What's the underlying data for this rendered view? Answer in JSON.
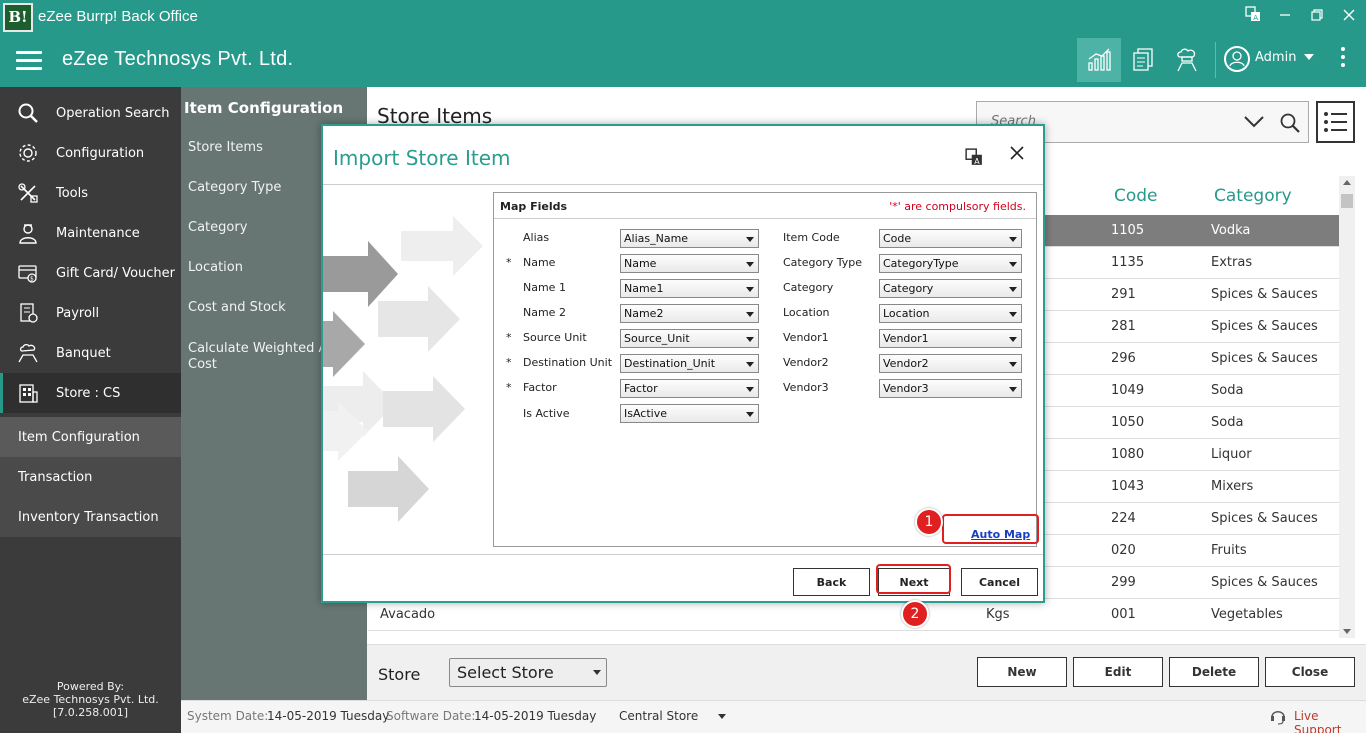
{
  "window": {
    "logo_text": "B!",
    "title": "eZee Burrp! Back Office"
  },
  "header": {
    "company": "eZee Technosys Pvt. Ltd.",
    "user": "Admin",
    "icons": [
      "chart-icon",
      "documents-icon",
      "chef-icon"
    ]
  },
  "sidebar": {
    "items": [
      {
        "label": "Operation Search",
        "icon": "search-icon"
      },
      {
        "label": "Configuration",
        "icon": "gear-icon"
      },
      {
        "label": "Tools",
        "icon": "tools-icon"
      },
      {
        "label": "Maintenance",
        "icon": "maintenance-icon"
      },
      {
        "label": "Gift Card/ Voucher",
        "icon": "gift-card-icon"
      },
      {
        "label": "Payroll",
        "icon": "payroll-icon"
      },
      {
        "label": "Banquet",
        "icon": "banquet-icon"
      },
      {
        "label": "Store : CS",
        "icon": "store-icon"
      }
    ],
    "sub_items": [
      {
        "label": "Item Configuration"
      },
      {
        "label": "Transaction"
      },
      {
        "label": "Inventory Transaction"
      }
    ],
    "powered_by": "Powered By:",
    "powered_company": "eZee Technosys Pvt. Ltd.",
    "version": "[7.0.258.001]"
  },
  "panel2": {
    "title": "Item Configuration",
    "items": [
      {
        "label": "Store Items"
      },
      {
        "label": "Category Type"
      },
      {
        "label": "Category"
      },
      {
        "label": "Location"
      },
      {
        "label": "Cost and Stock"
      },
      {
        "label": "Calculate Weighted Ave Cost"
      }
    ]
  },
  "main": {
    "title": "Store Items",
    "search_placeholder": "Search",
    "columns": {
      "code": "Code",
      "category": "Category"
    },
    "rows": [
      {
        "name": "",
        "unit": "",
        "code": "1105",
        "category": "Vodka"
      },
      {
        "name": "",
        "unit": "",
        "code": "1135",
        "category": "Extras"
      },
      {
        "name": "",
        "unit": "",
        "code": "291",
        "category": "Spices & Sauces"
      },
      {
        "name": "",
        "unit": "",
        "code": "281",
        "category": "Spices & Sauces"
      },
      {
        "name": "",
        "unit": "",
        "code": "296",
        "category": "Spices & Sauces"
      },
      {
        "name": "",
        "unit": "",
        "code": "1049",
        "category": "Soda"
      },
      {
        "name": "",
        "unit": "",
        "code": "1050",
        "category": "Soda"
      },
      {
        "name": "",
        "unit": "",
        "code": "1080",
        "category": "Liquor"
      },
      {
        "name": "",
        "unit": "",
        "code": "1043",
        "category": "Mixers"
      },
      {
        "name": "",
        "unit": "",
        "code": "224",
        "category": "Spices & Sauces"
      },
      {
        "name": "",
        "unit": "",
        "code": "020",
        "category": "Fruits"
      },
      {
        "name": "",
        "unit": "",
        "code": "299",
        "category": "Spices & Sauces"
      },
      {
        "name": "Avacado",
        "unit": "Kgs",
        "code": "001",
        "category": "Vegetables"
      }
    ],
    "store_label": "Store",
    "store_select": "Select Store",
    "buttons": {
      "new": "New",
      "edit": "Edit",
      "delete": "Delete",
      "close": "Close"
    }
  },
  "statusbar": {
    "system_date_label": "System Date:",
    "system_date": "14-05-2019 Tuesday",
    "software_date_label": "Software Date:",
    "software_date": "14-05-2019 Tuesday",
    "store": "Central Store",
    "live_support": "Live Support"
  },
  "modal": {
    "title": "Import Store Item",
    "map_fields_title": "Map Fields",
    "compulsory_note": "'*' are compulsory fields.",
    "left_fields": [
      {
        "star": "",
        "label": "Alias",
        "value": "Alias_Name"
      },
      {
        "star": "*",
        "label": "Name",
        "value": "Name"
      },
      {
        "star": "",
        "label": "Name 1",
        "value": "Name1"
      },
      {
        "star": "",
        "label": "Name 2",
        "value": "Name2"
      },
      {
        "star": "*",
        "label": "Source Unit",
        "value": "Source_Unit"
      },
      {
        "star": "*",
        "label": "Destination Unit",
        "value": "Destination_Unit"
      },
      {
        "star": "*",
        "label": "Factor",
        "value": "Factor"
      },
      {
        "star": "",
        "label": "Is Active",
        "value": "IsActive"
      }
    ],
    "right_fields": [
      {
        "label": "Item Code",
        "value": "Code"
      },
      {
        "label": "Category Type",
        "value": "CategoryType"
      },
      {
        "label": "Category",
        "value": "Category"
      },
      {
        "label": "Location",
        "value": "Location"
      },
      {
        "label": "Vendor1",
        "value": "Vendor1"
      },
      {
        "label": "Vendor2",
        "value": "Vendor2"
      },
      {
        "label": "Vendor3",
        "value": "Vendor3"
      }
    ],
    "auto_map": "Auto Map",
    "buttons": {
      "back": "Back",
      "next": "Next",
      "cancel": "Cancel"
    }
  },
  "annotations": {
    "marker1": "1",
    "marker2": "2"
  },
  "colors": {
    "accent": "#26998a",
    "sidebar": "#3b3b3b",
    "highlight": "#e02020"
  }
}
